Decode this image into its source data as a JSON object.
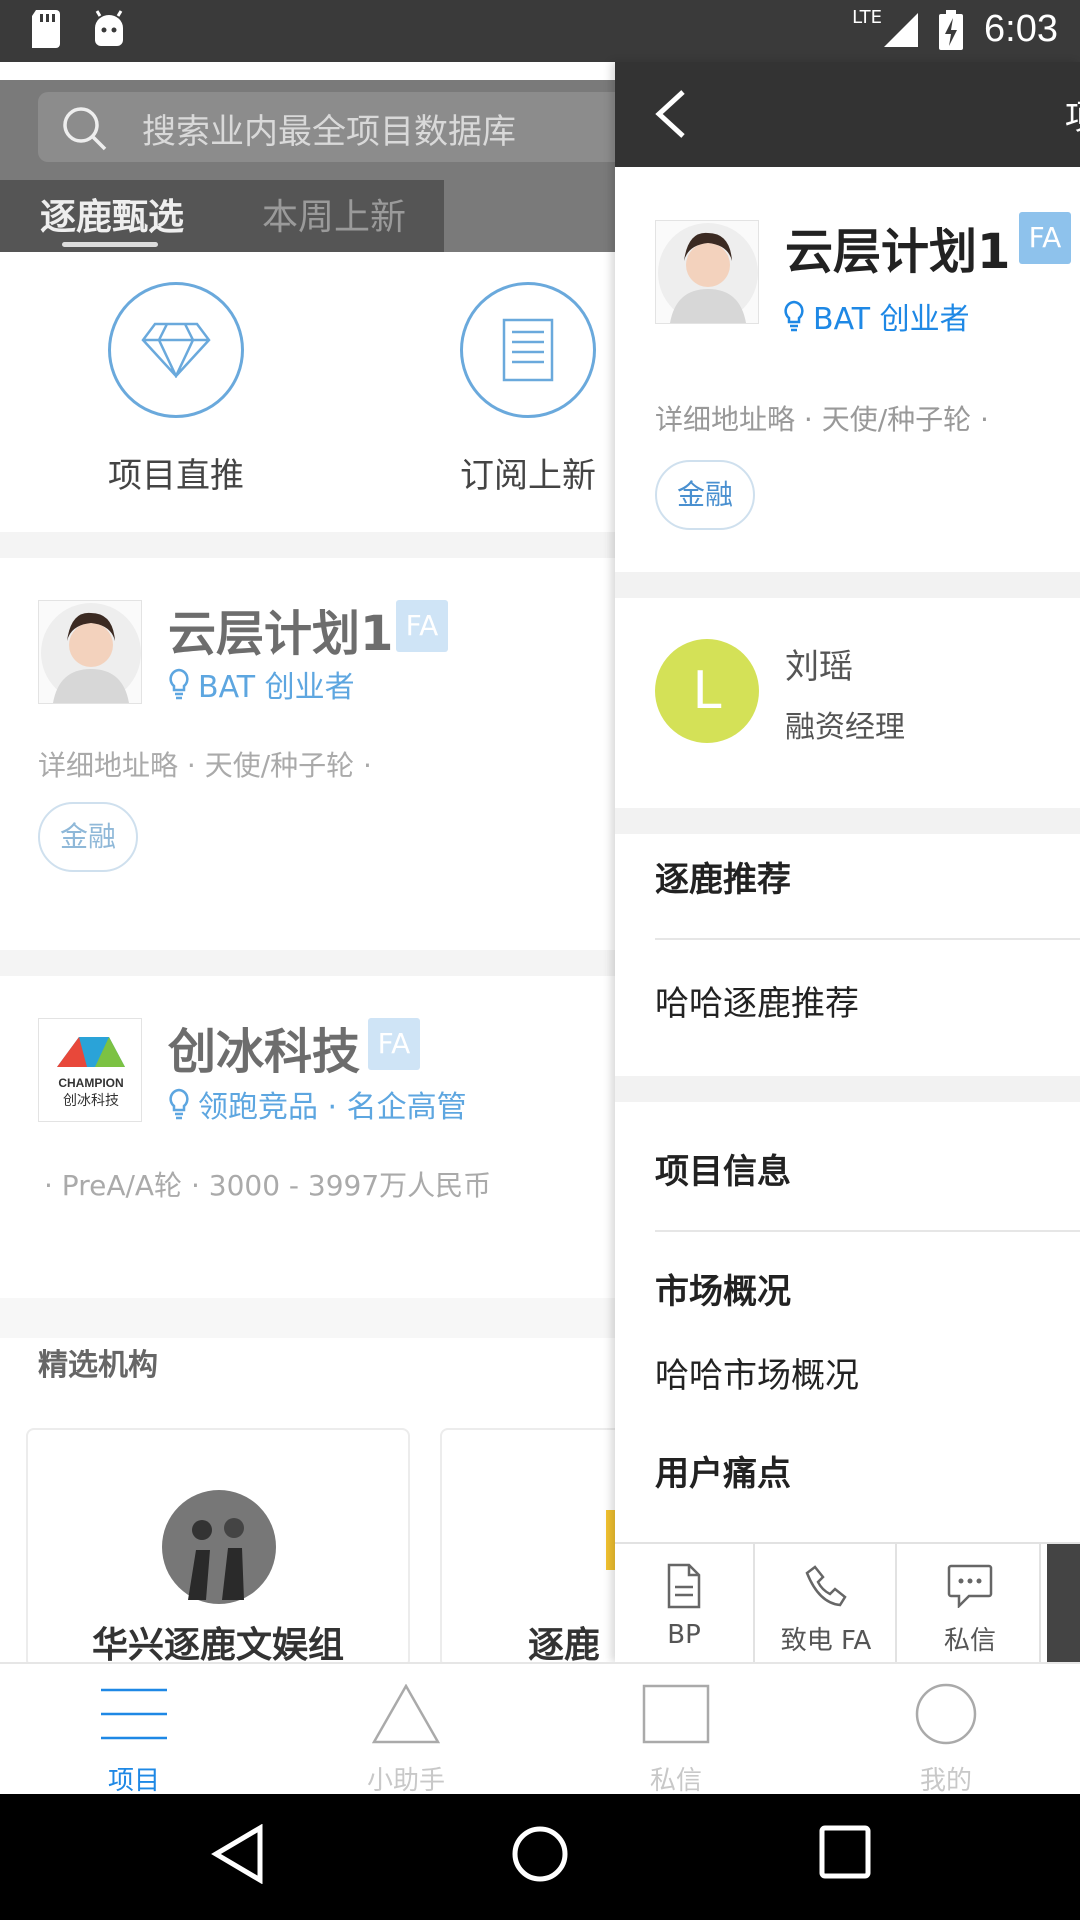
{
  "status_bar": {
    "time": "6:03",
    "network": "LTE"
  },
  "background_page": {
    "search_placeholder": "搜索业内最全项目数据库",
    "tabs": [
      "逐鹿甄选",
      "本周上新"
    ],
    "quick_actions": [
      {
        "label": "项目直推",
        "icon": "diamond-icon"
      },
      {
        "label": "订阅上新",
        "icon": "document-icon"
      }
    ],
    "projects": [
      {
        "title": "云层计划1",
        "badge": "FA",
        "tagline": "BAT 创业者",
        "meta": "详细地址略 · 天使/种子轮 ·",
        "tag": "金融"
      },
      {
        "title": "创冰科技",
        "badge": "FA",
        "tagline": "领跑竞品 · 名企高管",
        "meta": "· PreA/A轮 · 3000 - 3997万人民币"
      }
    ],
    "featured_section": "精选机构",
    "orgs": [
      "华兴逐鹿文娱组",
      "逐鹿"
    ]
  },
  "panel": {
    "clip_title": "项",
    "project": {
      "title": "云层计划1",
      "badge": "FA",
      "tagline": "BAT 创业者",
      "meta": "详细地址略 · 天使/种子轮 ·",
      "tag": "金融"
    },
    "contact": {
      "initial": "L",
      "name": "刘瑶",
      "role": "融资经理"
    },
    "sections": [
      {
        "title": "逐鹿推荐",
        "text": "哈哈逐鹿推荐"
      },
      {
        "title": "项目信息"
      },
      {
        "title": "市场概况",
        "text": "哈哈市场概况"
      },
      {
        "title": "用户痛点"
      }
    ],
    "actions": [
      "BP",
      "致电 FA",
      "私信"
    ]
  },
  "tabbar": {
    "items": [
      {
        "label": "项目",
        "active": true
      },
      {
        "label": "小助手",
        "active": false
      },
      {
        "label": "私信",
        "active": false
      },
      {
        "label": "我的",
        "active": false
      }
    ]
  },
  "colors": {
    "accent": "#1e88e5",
    "tag_bg": "#8ec2ec",
    "contact_avatar": "#d4e157",
    "header_dark": "#333333"
  }
}
